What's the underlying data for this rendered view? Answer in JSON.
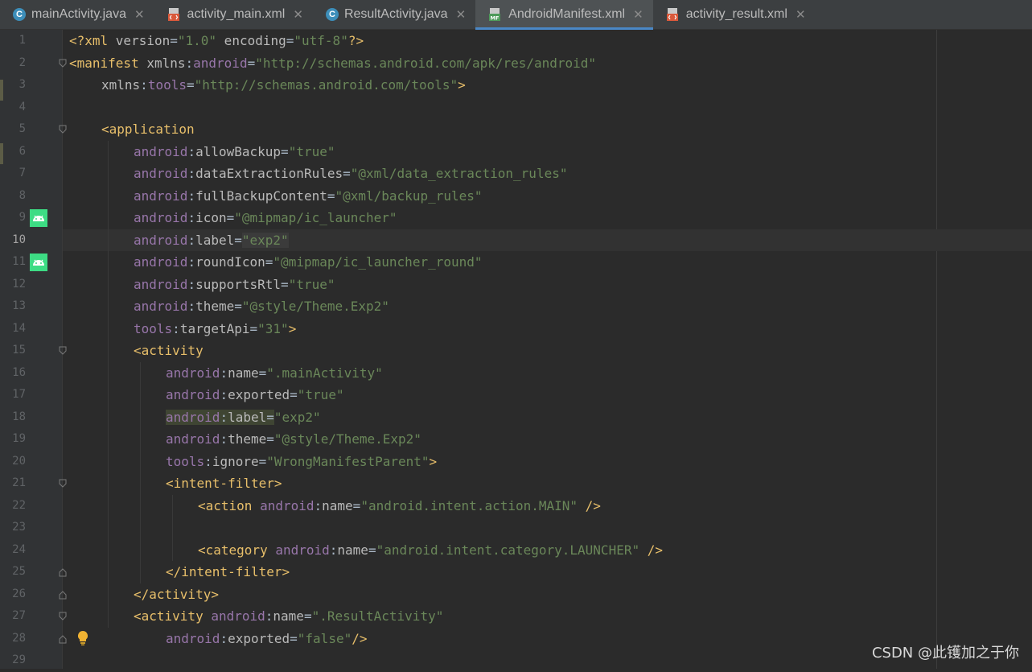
{
  "tabs": [
    {
      "label": "mainActivity.java",
      "icon": "java-class-icon",
      "active": false
    },
    {
      "label": "activity_main.xml",
      "icon": "layout-xml-icon",
      "active": false
    },
    {
      "label": "ResultActivity.java",
      "icon": "java-class-icon",
      "active": false
    },
    {
      "label": "AndroidManifest.xml",
      "icon": "manifest-icon",
      "active": true
    },
    {
      "label": "activity_result.xml",
      "icon": "layout-xml-icon",
      "active": false
    }
  ],
  "tab_close_glyph": "✕",
  "class_icon_letter": "C",
  "manifest_icon_text": "MF",
  "current_line": 10,
  "colors": {
    "accent": "#4a88c7",
    "tag": "#e8bf6a",
    "namespace": "#9876aa",
    "string": "#6a8759",
    "text": "#a9b7c6",
    "line_number": "#606366"
  },
  "gutter_icons": [
    {
      "line": 9,
      "icon": "android-icon"
    },
    {
      "line": 11,
      "icon": "android-icon"
    },
    {
      "line": 28,
      "icon": "lightbulb-icon"
    }
  ],
  "fold_markers": [
    {
      "line": 2,
      "kind": "open"
    },
    {
      "line": 5,
      "kind": "open"
    },
    {
      "line": 15,
      "kind": "open"
    },
    {
      "line": 21,
      "kind": "open"
    },
    {
      "line": 25,
      "kind": "close"
    },
    {
      "line": 26,
      "kind": "close"
    },
    {
      "line": 27,
      "kind": "open"
    },
    {
      "line": 28,
      "kind": "close"
    }
  ],
  "code_lines": [
    {
      "n": "1",
      "indent": 0,
      "tokens": [
        [
          "t",
          "<?xml "
        ],
        [
          "a",
          "version"
        ],
        [
          "p",
          "="
        ],
        [
          "v",
          "\"1.0\""
        ],
        [
          "a",
          " encoding"
        ],
        [
          "p",
          "="
        ],
        [
          "v",
          "\"utf-8\""
        ],
        [
          "t",
          "?>"
        ]
      ]
    },
    {
      "n": "2",
      "indent": 0,
      "tokens": [
        [
          "t",
          "<manifest "
        ],
        [
          "a",
          "xmlns"
        ],
        [
          "p",
          ":"
        ],
        [
          "ns",
          "android"
        ],
        [
          "p",
          "="
        ],
        [
          "v",
          "\"http://schemas.android.com/apk/res/android\""
        ]
      ]
    },
    {
      "n": "3",
      "indent": 1,
      "tokens": [
        [
          "a",
          "xmlns"
        ],
        [
          "p",
          ":"
        ],
        [
          "ns",
          "tools"
        ],
        [
          "p",
          "="
        ],
        [
          "v",
          "\"http://schemas.android.com/tools\""
        ],
        [
          "t",
          ">"
        ]
      ]
    },
    {
      "n": "4",
      "indent": 0,
      "tokens": []
    },
    {
      "n": "5",
      "indent": 1,
      "tokens": [
        [
          "t",
          "<application"
        ]
      ]
    },
    {
      "n": "6",
      "indent": 2,
      "tokens": [
        [
          "ns",
          "android"
        ],
        [
          "p",
          ":"
        ],
        [
          "a",
          "allowBackup"
        ],
        [
          "p",
          "="
        ],
        [
          "v",
          "\"true\""
        ]
      ]
    },
    {
      "n": "7",
      "indent": 2,
      "tokens": [
        [
          "ns",
          "android"
        ],
        [
          "p",
          ":"
        ],
        [
          "a",
          "dataExtractionRules"
        ],
        [
          "p",
          "="
        ],
        [
          "v",
          "\"@xml/data_extraction_rules\""
        ]
      ]
    },
    {
      "n": "8",
      "indent": 2,
      "tokens": [
        [
          "ns",
          "android"
        ],
        [
          "p",
          ":"
        ],
        [
          "a",
          "fullBackupContent"
        ],
        [
          "p",
          "="
        ],
        [
          "v",
          "\"@xml/backup_rules\""
        ]
      ]
    },
    {
      "n": "9",
      "indent": 2,
      "tokens": [
        [
          "ns",
          "android"
        ],
        [
          "p",
          ":"
        ],
        [
          "a",
          "icon"
        ],
        [
          "p",
          "="
        ],
        [
          "v",
          "\"@mipmap/ic_launcher\""
        ]
      ]
    },
    {
      "n": "10",
      "indent": 2,
      "tokens": [
        [
          "ns",
          "android"
        ],
        [
          "p",
          ":"
        ],
        [
          "a",
          "label"
        ],
        [
          "p",
          "="
        ],
        [
          "v hl-ident",
          "\"exp2\""
        ]
      ]
    },
    {
      "n": "11",
      "indent": 2,
      "tokens": [
        [
          "ns",
          "android"
        ],
        [
          "p",
          ":"
        ],
        [
          "a",
          "roundIcon"
        ],
        [
          "p",
          "="
        ],
        [
          "v",
          "\"@mipmap/ic_launcher_round\""
        ]
      ]
    },
    {
      "n": "12",
      "indent": 2,
      "tokens": [
        [
          "ns",
          "android"
        ],
        [
          "p",
          ":"
        ],
        [
          "a",
          "supportsRtl"
        ],
        [
          "p",
          "="
        ],
        [
          "v",
          "\"true\""
        ]
      ]
    },
    {
      "n": "13",
      "indent": 2,
      "tokens": [
        [
          "ns",
          "android"
        ],
        [
          "p",
          ":"
        ],
        [
          "a",
          "theme"
        ],
        [
          "p",
          "="
        ],
        [
          "v",
          "\"@style/Theme.Exp2\""
        ]
      ]
    },
    {
      "n": "14",
      "indent": 2,
      "tokens": [
        [
          "ns",
          "tools"
        ],
        [
          "p",
          ":"
        ],
        [
          "a",
          "targetApi"
        ],
        [
          "p",
          "="
        ],
        [
          "v",
          "\"31\""
        ],
        [
          "t",
          ">"
        ]
      ]
    },
    {
      "n": "15",
      "indent": 2,
      "tokens": [
        [
          "t",
          "<activity"
        ]
      ]
    },
    {
      "n": "16",
      "indent": 3,
      "tokens": [
        [
          "ns",
          "android"
        ],
        [
          "p",
          ":"
        ],
        [
          "a",
          "name"
        ],
        [
          "p",
          "="
        ],
        [
          "v",
          "\".mainActivity\""
        ]
      ]
    },
    {
      "n": "17",
      "indent": 3,
      "tokens": [
        [
          "ns",
          "android"
        ],
        [
          "p",
          ":"
        ],
        [
          "a",
          "exported"
        ],
        [
          "p",
          "="
        ],
        [
          "v",
          "\"true\""
        ]
      ]
    },
    {
      "n": "18",
      "indent": 3,
      "tokens": [
        [
          "ns hl-usage",
          "android"
        ],
        [
          "p hl-usage",
          ":"
        ],
        [
          "a hl-usage",
          "label"
        ],
        [
          "p hl-usage",
          "="
        ],
        [
          "v",
          "\"exp2\""
        ]
      ]
    },
    {
      "n": "19",
      "indent": 3,
      "tokens": [
        [
          "ns",
          "android"
        ],
        [
          "p",
          ":"
        ],
        [
          "a",
          "theme"
        ],
        [
          "p",
          "="
        ],
        [
          "v",
          "\"@style/Theme.Exp2\""
        ]
      ]
    },
    {
      "n": "20",
      "indent": 3,
      "tokens": [
        [
          "ns",
          "tools"
        ],
        [
          "p",
          ":"
        ],
        [
          "a",
          "ignore"
        ],
        [
          "p",
          "="
        ],
        [
          "v",
          "\"WrongManifestParent\""
        ],
        [
          "t",
          ">"
        ]
      ]
    },
    {
      "n": "21",
      "indent": 3,
      "tokens": [
        [
          "t",
          "<intent-filter>"
        ]
      ]
    },
    {
      "n": "22",
      "indent": 4,
      "tokens": [
        [
          "t",
          "<action "
        ],
        [
          "ns",
          "android"
        ],
        [
          "p",
          ":"
        ],
        [
          "a",
          "name"
        ],
        [
          "p",
          "="
        ],
        [
          "v",
          "\"android.intent.action.MAIN\""
        ],
        [
          "t",
          " />"
        ]
      ]
    },
    {
      "n": "23",
      "indent": 0,
      "tokens": []
    },
    {
      "n": "24",
      "indent": 4,
      "tokens": [
        [
          "t",
          "<category "
        ],
        [
          "ns",
          "android"
        ],
        [
          "p",
          ":"
        ],
        [
          "a",
          "name"
        ],
        [
          "p",
          "="
        ],
        [
          "v",
          "\"android.intent.category.LAUNCHER\""
        ],
        [
          "t",
          " />"
        ]
      ]
    },
    {
      "n": "25",
      "indent": 3,
      "tokens": [
        [
          "t",
          "</intent-filter>"
        ]
      ]
    },
    {
      "n": "26",
      "indent": 2,
      "tokens": [
        [
          "t",
          "</activity>"
        ]
      ]
    },
    {
      "n": "27",
      "indent": 2,
      "tokens": [
        [
          "t",
          "<activity "
        ],
        [
          "ns",
          "android"
        ],
        [
          "p",
          ":"
        ],
        [
          "a",
          "name"
        ],
        [
          "p",
          "="
        ],
        [
          "v",
          "\".ResultActivity\""
        ]
      ]
    },
    {
      "n": "28",
      "indent": 3,
      "tokens": [
        [
          "ns",
          "android"
        ],
        [
          "p",
          ":"
        ],
        [
          "a",
          "exported"
        ],
        [
          "p",
          "="
        ],
        [
          "v",
          "\"false\""
        ],
        [
          "t",
          "/>"
        ]
      ]
    },
    {
      "n": "29",
      "indent": 0,
      "tokens": []
    }
  ],
  "watermark": "CSDN @此镬加之于你"
}
